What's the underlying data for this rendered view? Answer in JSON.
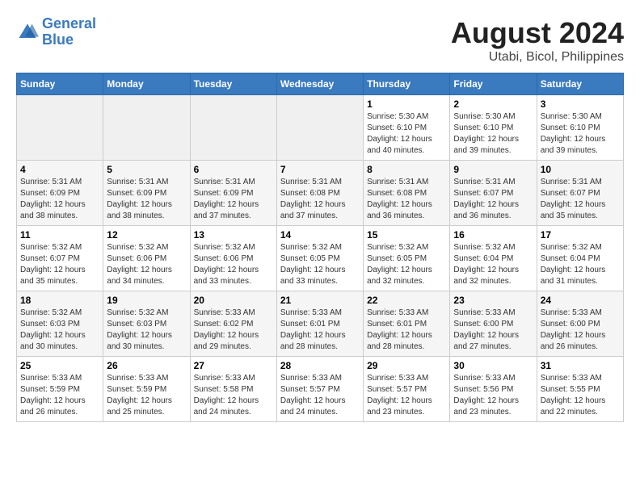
{
  "header": {
    "logo_line1": "General",
    "logo_line2": "Blue",
    "main_title": "August 2024",
    "subtitle": "Utabi, Bicol, Philippines"
  },
  "days_of_week": [
    "Sunday",
    "Monday",
    "Tuesday",
    "Wednesday",
    "Thursday",
    "Friday",
    "Saturday"
  ],
  "weeks": [
    [
      {
        "day": "",
        "info": ""
      },
      {
        "day": "",
        "info": ""
      },
      {
        "day": "",
        "info": ""
      },
      {
        "day": "",
        "info": ""
      },
      {
        "day": "1",
        "info": "Sunrise: 5:30 AM\nSunset: 6:10 PM\nDaylight: 12 hours\nand 40 minutes."
      },
      {
        "day": "2",
        "info": "Sunrise: 5:30 AM\nSunset: 6:10 PM\nDaylight: 12 hours\nand 39 minutes."
      },
      {
        "day": "3",
        "info": "Sunrise: 5:30 AM\nSunset: 6:10 PM\nDaylight: 12 hours\nand 39 minutes."
      }
    ],
    [
      {
        "day": "4",
        "info": "Sunrise: 5:31 AM\nSunset: 6:09 PM\nDaylight: 12 hours\nand 38 minutes."
      },
      {
        "day": "5",
        "info": "Sunrise: 5:31 AM\nSunset: 6:09 PM\nDaylight: 12 hours\nand 38 minutes."
      },
      {
        "day": "6",
        "info": "Sunrise: 5:31 AM\nSunset: 6:09 PM\nDaylight: 12 hours\nand 37 minutes."
      },
      {
        "day": "7",
        "info": "Sunrise: 5:31 AM\nSunset: 6:08 PM\nDaylight: 12 hours\nand 37 minutes."
      },
      {
        "day": "8",
        "info": "Sunrise: 5:31 AM\nSunset: 6:08 PM\nDaylight: 12 hours\nand 36 minutes."
      },
      {
        "day": "9",
        "info": "Sunrise: 5:31 AM\nSunset: 6:07 PM\nDaylight: 12 hours\nand 36 minutes."
      },
      {
        "day": "10",
        "info": "Sunrise: 5:31 AM\nSunset: 6:07 PM\nDaylight: 12 hours\nand 35 minutes."
      }
    ],
    [
      {
        "day": "11",
        "info": "Sunrise: 5:32 AM\nSunset: 6:07 PM\nDaylight: 12 hours\nand 35 minutes."
      },
      {
        "day": "12",
        "info": "Sunrise: 5:32 AM\nSunset: 6:06 PM\nDaylight: 12 hours\nand 34 minutes."
      },
      {
        "day": "13",
        "info": "Sunrise: 5:32 AM\nSunset: 6:06 PM\nDaylight: 12 hours\nand 33 minutes."
      },
      {
        "day": "14",
        "info": "Sunrise: 5:32 AM\nSunset: 6:05 PM\nDaylight: 12 hours\nand 33 minutes."
      },
      {
        "day": "15",
        "info": "Sunrise: 5:32 AM\nSunset: 6:05 PM\nDaylight: 12 hours\nand 32 minutes."
      },
      {
        "day": "16",
        "info": "Sunrise: 5:32 AM\nSunset: 6:04 PM\nDaylight: 12 hours\nand 32 minutes."
      },
      {
        "day": "17",
        "info": "Sunrise: 5:32 AM\nSunset: 6:04 PM\nDaylight: 12 hours\nand 31 minutes."
      }
    ],
    [
      {
        "day": "18",
        "info": "Sunrise: 5:32 AM\nSunset: 6:03 PM\nDaylight: 12 hours\nand 30 minutes."
      },
      {
        "day": "19",
        "info": "Sunrise: 5:32 AM\nSunset: 6:03 PM\nDaylight: 12 hours\nand 30 minutes."
      },
      {
        "day": "20",
        "info": "Sunrise: 5:33 AM\nSunset: 6:02 PM\nDaylight: 12 hours\nand 29 minutes."
      },
      {
        "day": "21",
        "info": "Sunrise: 5:33 AM\nSunset: 6:01 PM\nDaylight: 12 hours\nand 28 minutes."
      },
      {
        "day": "22",
        "info": "Sunrise: 5:33 AM\nSunset: 6:01 PM\nDaylight: 12 hours\nand 28 minutes."
      },
      {
        "day": "23",
        "info": "Sunrise: 5:33 AM\nSunset: 6:00 PM\nDaylight: 12 hours\nand 27 minutes."
      },
      {
        "day": "24",
        "info": "Sunrise: 5:33 AM\nSunset: 6:00 PM\nDaylight: 12 hours\nand 26 minutes."
      }
    ],
    [
      {
        "day": "25",
        "info": "Sunrise: 5:33 AM\nSunset: 5:59 PM\nDaylight: 12 hours\nand 26 minutes."
      },
      {
        "day": "26",
        "info": "Sunrise: 5:33 AM\nSunset: 5:59 PM\nDaylight: 12 hours\nand 25 minutes."
      },
      {
        "day": "27",
        "info": "Sunrise: 5:33 AM\nSunset: 5:58 PM\nDaylight: 12 hours\nand 24 minutes."
      },
      {
        "day": "28",
        "info": "Sunrise: 5:33 AM\nSunset: 5:57 PM\nDaylight: 12 hours\nand 24 minutes."
      },
      {
        "day": "29",
        "info": "Sunrise: 5:33 AM\nSunset: 5:57 PM\nDaylight: 12 hours\nand 23 minutes."
      },
      {
        "day": "30",
        "info": "Sunrise: 5:33 AM\nSunset: 5:56 PM\nDaylight: 12 hours\nand 23 minutes."
      },
      {
        "day": "31",
        "info": "Sunrise: 5:33 AM\nSunset: 5:55 PM\nDaylight: 12 hours\nand 22 minutes."
      }
    ]
  ]
}
